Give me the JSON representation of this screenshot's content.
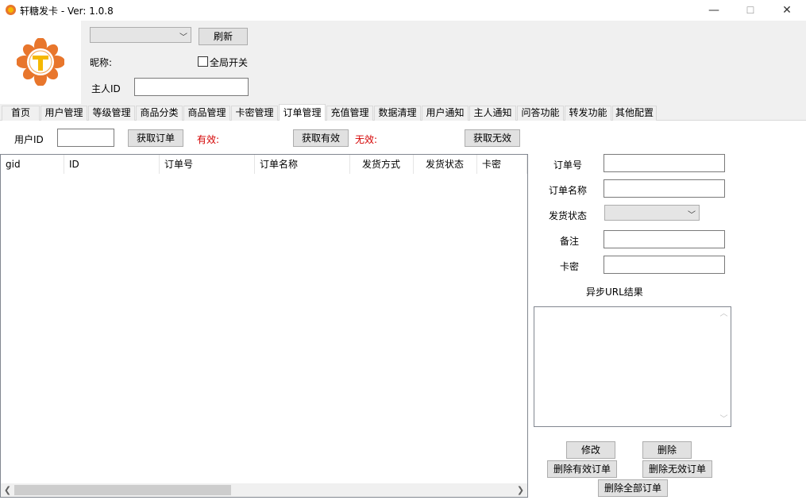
{
  "window": {
    "title": "轩糖发卡 - Ver: 1.0.8",
    "minimize_glyph": "—",
    "maximize_glyph": "☐",
    "close_glyph": "✕"
  },
  "header": {
    "refresh_label": "刷新",
    "nickname_label": "昵称:",
    "global_switch_label": "全局开关",
    "owner_id_label": "主人ID",
    "owner_id_value": "",
    "account_select_value": ""
  },
  "tabs": [
    {
      "label": "首页"
    },
    {
      "label": "用户管理"
    },
    {
      "label": "等级管理"
    },
    {
      "label": "商品分类"
    },
    {
      "label": "商品管理"
    },
    {
      "label": "卡密管理"
    },
    {
      "label": "订单管理",
      "active": true
    },
    {
      "label": "充值管理"
    },
    {
      "label": "数据清理"
    },
    {
      "label": "用户通知"
    },
    {
      "label": "主人通知"
    },
    {
      "label": "问答功能"
    },
    {
      "label": "转发功能"
    },
    {
      "label": "其他配置"
    }
  ],
  "orders": {
    "user_id_label": "用户ID",
    "user_id_value": "",
    "get_orders_label": "获取订单",
    "valid_label": "有效:",
    "get_valid_label": "获取有效",
    "invalid_label": "无效:",
    "get_invalid_label": "获取无效",
    "columns": [
      "gid",
      "ID",
      "订单号",
      "订单名称",
      "发货方式",
      "发货状态",
      "卡密"
    ]
  },
  "detail": {
    "order_no_label": "订单号",
    "order_name_label": "订单名称",
    "ship_status_label": "发货状态",
    "remark_label": "备注",
    "card_key_label": "卡密",
    "async_url_label": "异步URL结果",
    "modify_label": "修改",
    "delete_label": "删除",
    "delete_valid_label": "删除有效订单",
    "delete_invalid_label": "删除无效订单",
    "delete_all_label": "删除全部订单"
  },
  "colors": {
    "logo_orange": "#e8762c",
    "logo_yellow": "#f5b800",
    "valid_red": "#d40000"
  }
}
